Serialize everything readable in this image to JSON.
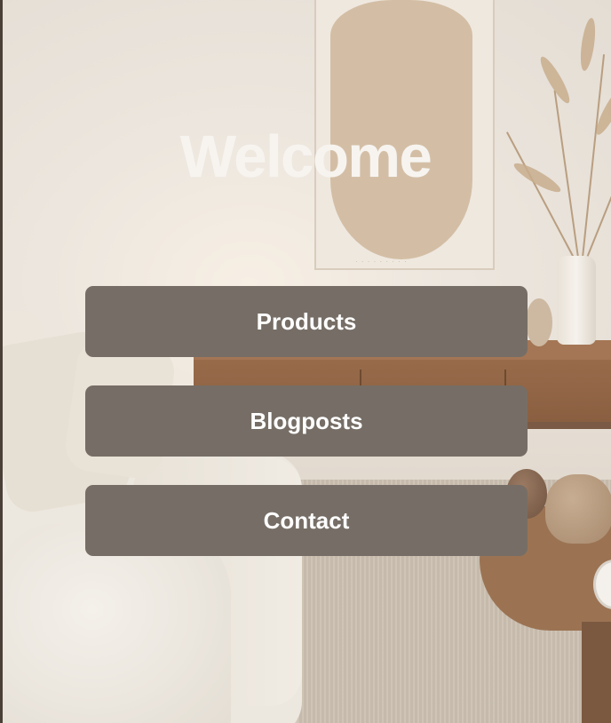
{
  "page": {
    "title": "Welcome",
    "buttons": {
      "products": "Products",
      "blogposts": "Blogposts",
      "contact": "Contact"
    }
  },
  "colors": {
    "button_background": "#766e66",
    "button_text": "#ffffff",
    "title_text": "#f7f4f0"
  }
}
